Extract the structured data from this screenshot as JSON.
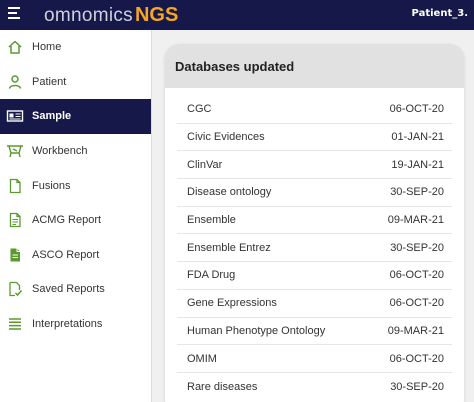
{
  "header": {
    "brand_prefix": "omnomics",
    "brand_suffix": "NGS",
    "user": "Patient_3."
  },
  "sidebar": {
    "items": [
      {
        "label": "Home",
        "icon": "home-icon"
      },
      {
        "label": "Patient",
        "icon": "person-icon"
      },
      {
        "label": "Sample",
        "icon": "sample-card-icon",
        "active": true
      },
      {
        "label": "Workbench",
        "icon": "workbench-icon"
      },
      {
        "label": "Fusions",
        "icon": "document-icon"
      },
      {
        "label": "ACMG Report",
        "icon": "report-icon"
      },
      {
        "label": "ASCO Report",
        "icon": "report-filled-icon"
      },
      {
        "label": "Saved Reports",
        "icon": "saved-report-icon"
      },
      {
        "label": "Interpretations",
        "icon": "list-icon"
      }
    ]
  },
  "card": {
    "title": "Databases updated",
    "rows": [
      {
        "name": "CGC",
        "date": "06-OCT-20"
      },
      {
        "name": "Civic Evidences",
        "date": "01-JAN-21"
      },
      {
        "name": "ClinVar",
        "date": "19-JAN-21"
      },
      {
        "name": "Disease ontology",
        "date": "30-SEP-20"
      },
      {
        "name": "Ensemble",
        "date": "09-MAR-21"
      },
      {
        "name": "Ensemble Entrez",
        "date": "30-SEP-20"
      },
      {
        "name": "FDA Drug",
        "date": "06-OCT-20"
      },
      {
        "name": "Gene Expressions",
        "date": "06-OCT-20"
      },
      {
        "name": "Human Phenotype Ontology",
        "date": "09-MAR-21"
      },
      {
        "name": "OMIM",
        "date": "06-OCT-20"
      },
      {
        "name": "Rare diseases",
        "date": "30-SEP-20"
      }
    ]
  },
  "colors": {
    "topbar": "#16184a",
    "accent": "#f5a623",
    "icon_green": "#5a9a2e",
    "active_bg": "#16184a"
  }
}
